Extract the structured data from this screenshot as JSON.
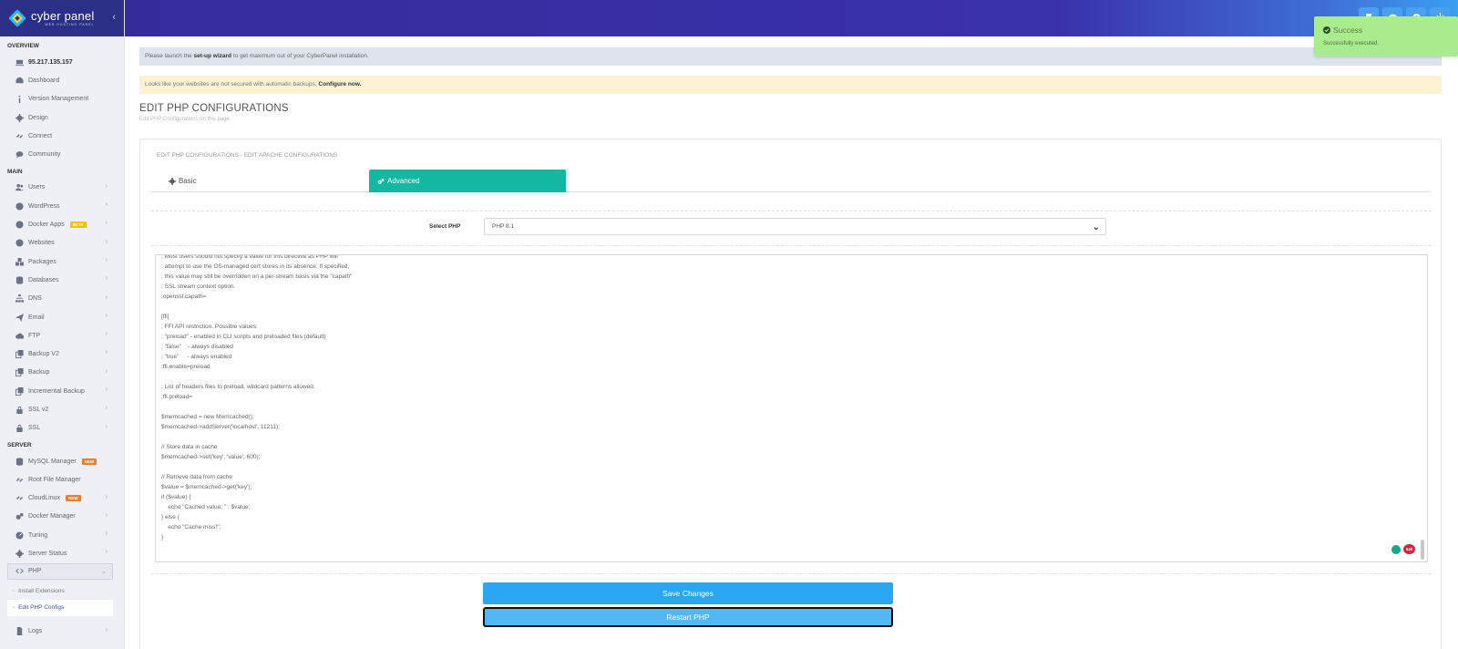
{
  "brand": {
    "name": "cyber panel",
    "tagline": "WEB HOSTING PANEL",
    "color": "#2b2f86"
  },
  "sidebar": {
    "overview_label": "OVERVIEW",
    "main_label": "MAIN",
    "server_label": "SERVER",
    "overview": [
      {
        "label": "95.217.135.157",
        "icon": "laptop-icon"
      },
      {
        "label": "Dashboard",
        "icon": "dashboard-icon"
      },
      {
        "label": "Version Management",
        "icon": "info-icon"
      },
      {
        "label": "Design",
        "icon": "gear-icon"
      },
      {
        "label": "Connect",
        "icon": "link-icon"
      },
      {
        "label": "Community",
        "icon": "chat-icon"
      }
    ],
    "main": [
      {
        "label": "Users",
        "icon": "users-icon"
      },
      {
        "label": "WordPress",
        "icon": "wordpress-icon"
      },
      {
        "label": "Docker Apps",
        "icon": "docker-icon",
        "badge": "BETA"
      },
      {
        "label": "Websites",
        "icon": "globe-icon"
      },
      {
        "label": "Packages",
        "icon": "cubes-icon"
      },
      {
        "label": "Databases",
        "icon": "database-icon"
      },
      {
        "label": "DNS",
        "icon": "sitemap-icon"
      },
      {
        "label": "Email",
        "icon": "paper-plane-icon"
      },
      {
        "label": "FTP",
        "icon": "cloud-upload-icon"
      },
      {
        "label": "Backup V2",
        "icon": "copy-icon"
      },
      {
        "label": "Backup",
        "icon": "copy-icon"
      },
      {
        "label": "Incremental Backup",
        "icon": "copy-icon"
      },
      {
        "label": "SSL v2",
        "icon": "lock-icon"
      },
      {
        "label": "SSL",
        "icon": "lock-icon"
      }
    ],
    "server": [
      {
        "label": "MySQL Manager",
        "icon": "database-icon",
        "badge": "NEW"
      },
      {
        "label": "Root File Manager",
        "icon": "link-icon"
      },
      {
        "label": "CloudLinux",
        "icon": "link-icon",
        "badge": "NEW"
      },
      {
        "label": "Docker Manager",
        "icon": "cogs-icon"
      },
      {
        "label": "Tuning",
        "icon": "gauge-icon"
      },
      {
        "label": "Server Status",
        "icon": "gear-icon"
      },
      {
        "label": "PHP",
        "icon": "code-icon"
      }
    ],
    "php_sub": [
      {
        "label": "Install Extensions"
      },
      {
        "label": "Edit PHP Configs"
      }
    ],
    "logs": {
      "label": "Logs",
      "icon": "file-icon"
    }
  },
  "alerts": {
    "setup_prefix": "Please launch the ",
    "setup_link": "set-up wizard",
    "setup_suffix": " to get maximum out of your CyberPanel installation.",
    "backup_text": "Looks like your websites are not secured with automatic backups. ",
    "backup_link": "Configure now."
  },
  "page": {
    "title": "EDIT PHP CONFIGURATIONS",
    "subtitle": "Edit PHP Configurations on this page",
    "panel_title": "EDIT PHP CONFIGURATIONS - EDIT APACHE CONFIGURATIONS",
    "tabs": {
      "basic": "Basic",
      "advanced": "Advanced"
    },
    "select_label": "Select PHP",
    "select_value": "PHP 8.1",
    "code_lines": [
      "; Most users should not specify a value for this directive as PHP will",
      "; attempt to use the OS-managed cert stores in its absence. If specified,",
      "; this value may still be overridden on a per-stream basis via the \"capath\"",
      "; SSL stream context option.",
      ";openssl.capath=",
      "",
      "[ffi]",
      "; FFI API restriction. Possible values:",
      "; \"preload\" - enabled in CLI scripts and preloaded files (default)",
      "; \"false\"    - always disabled",
      "; \"true\"     - always enabled",
      ";ffi.enable=preload",
      "",
      "; List of headers files to preload, wildcard patterns allowed.",
      ";ffi.preload=",
      "",
      "$memcached = new Memcached();",
      "$memcached->addServer('localhost', 11211);",
      "",
      "// Store data in cache",
      "$memcached->set('key', 'value', 600);",
      "",
      "// Retrieve data from cache",
      "$value = $memcached->get('key');",
      "if ($value) {",
      "    echo \"Cached value: \" . $value;",
      "} else {",
      "    echo \"Cache miss!\";",
      "}"
    ],
    "grammar_count": "640",
    "save_label": "Save Changes",
    "restart_label": "Restart PHP"
  },
  "toast": {
    "title": "Success",
    "message": "Successfully executed.",
    "color": "#a8ec8d"
  },
  "colors": {
    "accent_tab": "#12b8a0",
    "primary_button": "#29a7f2"
  }
}
